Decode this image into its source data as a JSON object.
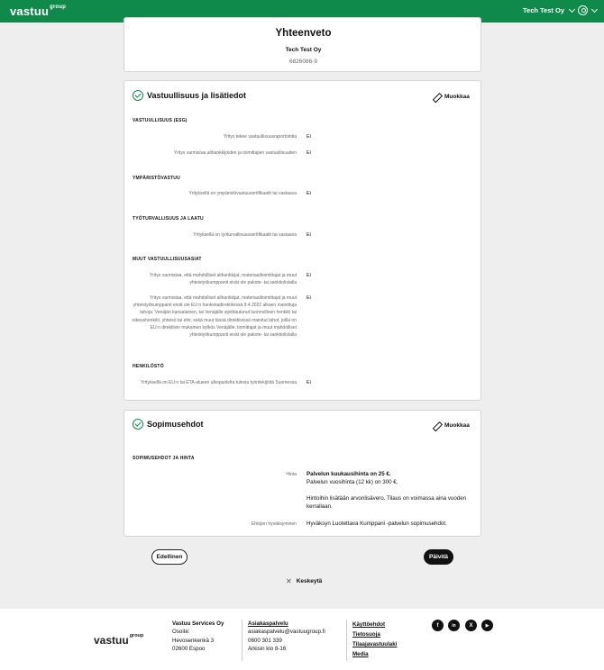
{
  "header": {
    "logo": "vastuu",
    "logo_sup": "group",
    "company_name": "Tech Test Oy"
  },
  "summary": {
    "title": "Yhteenveto",
    "company": "Tech Test Oy",
    "business_id": "6826086-9"
  },
  "responsibility": {
    "title": "Vastuullisuus ja lisätiedot",
    "edit_label": "Muokkaa",
    "groups": [
      {
        "heading": "VASTUULLISUUS (ESG)",
        "items": [
          {
            "question": "Yritys tekee vastuullisuusraportointia",
            "answer": "Ei"
          },
          {
            "question": "Yritys varmistaa alihankkijoiden ja toimittajien vastuullisuuden",
            "answer": "Ei"
          }
        ]
      },
      {
        "heading": "YMPÄRISTÖVASTUU",
        "items": [
          {
            "question": "Yrityksellä on ympäristövastuusertifikaatti tai vastaava",
            "answer": "Ei"
          }
        ]
      },
      {
        "heading": "TYÖTURVALLISUUS JA LAATU",
        "items": [
          {
            "question": "Yrityksellä on työturvallisuussertifikaatti tai vastaava",
            "answer": "Ei"
          }
        ]
      },
      {
        "heading": "MUUT VASTUULLISUUSASIAT",
        "items": [
          {
            "question": "Yritys varmistaa, että mahdolliset alihankkijat, materiaalitoimittajat ja muut yhteistyökumppanit eivät ole pakote- tai sanktiolistalla",
            "answer": "Ei"
          },
          {
            "question": "Yritys varmistaa, että mahdolliset alihankkijat, materiaalitoimittajat ja muut yhteistyökumppanit eivät ole EU:n hankintadirektiivissä 9.4.2022 alkaen mainittuja tahoja: Venäjän kansalainen, tai Venäjälle sijoittautunut luonnollinen henkilö tai oikeushenkilö, yhteisö tai elin; sekä muut tässä direktiivissä mainitut tahot, joilla on EU:n direktiivin mukainen kytkös Venäjälle; toimittajat ja muut mahdolliset yhteistyökumppanit eivät ole pakote- tai sanktiolistalla",
            "answer": "Ei"
          }
        ]
      },
      {
        "heading": "HENKILÖSTÖ",
        "items": [
          {
            "question": "Yrityksellä on EU:n tai ETA-alueen ulkopuolelta tulevia työntekijöitä Suomessa",
            "answer": "Ei"
          }
        ]
      }
    ]
  },
  "agreement": {
    "title": "Sopimusehdot",
    "edit_label": "Muokkaa",
    "heading": "SOPIMUSEHDOT JA HINTA",
    "price_label": "Hinta",
    "price_line1": "Palvelun kuukausihinta on 25 €.",
    "price_line2": "Palvelun vuosihinta (12 kk) on 300 €.",
    "price_note": "Hintoihin lisätään arvonlisävero. Tilaus on voimassa aina vuoden kerrallaan.",
    "terms_label": "Ehtojen hyväksyminen",
    "terms_value": "Hyväksyn Luotettava Kumppani -palvelun sopimusehdot."
  },
  "actions": {
    "previous": "Edellinen",
    "update": "Päivitä",
    "cancel": "Keskeytä"
  },
  "footer": {
    "logo": "vastuu",
    "logo_sup": "group",
    "company": "Vastuu Services Oy",
    "address_label": "Osoite:",
    "street": "Hevosenkenkä 3",
    "city": "02600 Espoo",
    "support_title": "Asiakaspalvelu",
    "email": "asiakaspalvelu@vastuugroup.fi",
    "phone": "0600 301 339",
    "hours": "Arkisin klo 8-16",
    "links": [
      "Käyttöehdot",
      "Tietosuoja",
      "Tilaajavastuulaki",
      "Media"
    ],
    "social": [
      {
        "icon": "facebook-icon",
        "glyph": "f"
      },
      {
        "icon": "linkedin-icon",
        "glyph": "in"
      },
      {
        "icon": "x-icon",
        "glyph": "X"
      },
      {
        "icon": "youtube-icon",
        "glyph": "▶"
      }
    ]
  }
}
